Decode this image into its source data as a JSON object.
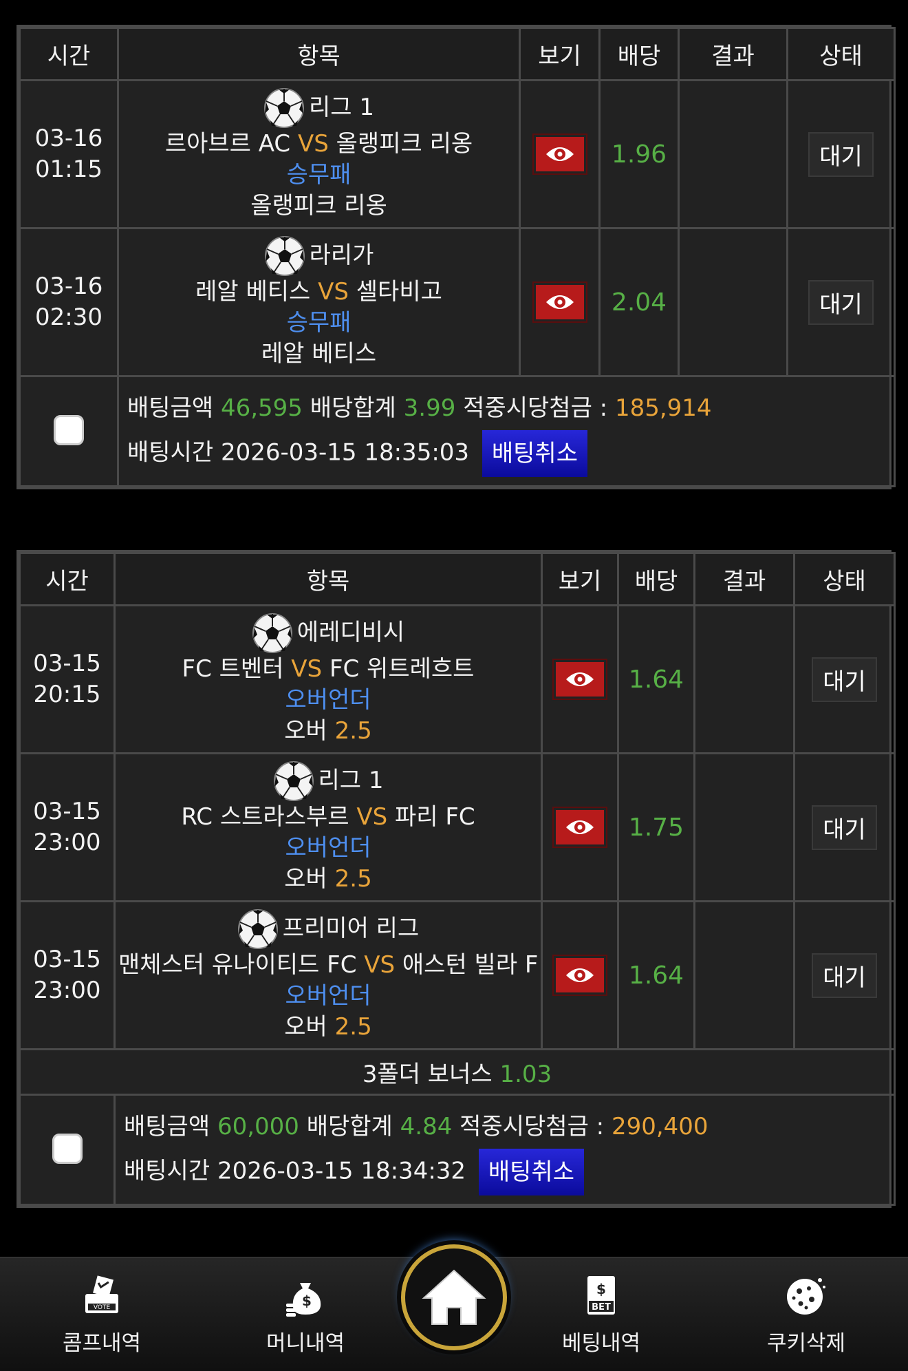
{
  "headers": {
    "time": "시간",
    "item": "항목",
    "view": "보기",
    "odds": "배당",
    "result": "결과",
    "status": "상태"
  },
  "colors": {
    "vs": "#e9a43a",
    "market": "#4e8ff0",
    "odds": "#57b046",
    "eye_button": "#b71b1b",
    "cancel_button": "#1a1ab8"
  },
  "slip1": {
    "rows": [
      {
        "date": "03-16",
        "time": "01:15",
        "league": "리그 1",
        "home": "르아브르 AC",
        "vs": "VS",
        "away": "올랭피크 리옹",
        "market": "승무패",
        "pick": "올랭피크 리옹",
        "odds": "1.96",
        "result": "",
        "status": "대기"
      },
      {
        "date": "03-16",
        "time": "02:30",
        "league": "라리가",
        "home": "레알 베티스",
        "vs": "VS",
        "away": "셀타비고",
        "market": "승무패",
        "pick": "레알 베티스",
        "odds": "2.04",
        "result": "",
        "status": "대기"
      }
    ],
    "summary": {
      "amount_label": "배팅금액",
      "amount": "46,595",
      "total_odds_label": "배당합계",
      "total_odds": "3.99",
      "payout_label": "적중시당첨금 :",
      "payout": "185,914",
      "bet_time_label": "배팅시간",
      "bet_time": "2026-03-15 18:35:03",
      "cancel_label": "배팅취소"
    }
  },
  "slip2": {
    "rows": [
      {
        "date": "03-15",
        "time": "20:15",
        "league": "에레디비시",
        "home": "FC 트벤터",
        "vs": "VS",
        "away": "FC 위트레흐트",
        "market": "오버언더",
        "pick_label": "오버",
        "pick_value": "2.5",
        "odds": "1.64",
        "result": "",
        "status": "대기"
      },
      {
        "date": "03-15",
        "time": "23:00",
        "league": "리그 1",
        "home": "RC 스트라스부르",
        "vs": "VS",
        "away": "파리 FC",
        "market": "오버언더",
        "pick_label": "오버",
        "pick_value": "2.5",
        "odds": "1.75",
        "result": "",
        "status": "대기"
      },
      {
        "date": "03-15",
        "time": "23:00",
        "league": "프리미어 리그",
        "home": "맨체스터 유나이티드 FC",
        "vs": "VS",
        "away": "애스턴 빌라 F",
        "market": "오버언더",
        "pick_label": "오버",
        "pick_value": "2.5",
        "odds": "1.64",
        "result": "",
        "status": "대기"
      }
    ],
    "bonus": {
      "label": "3폴더 보너스",
      "value": "1.03"
    },
    "summary": {
      "amount_label": "배팅금액",
      "amount": "60,000",
      "total_odds_label": "배당합계",
      "total_odds": "4.84",
      "payout_label": "적중시당첨금 :",
      "payout": "290,400",
      "bet_time_label": "배팅시간",
      "bet_time": "2026-03-15 18:34:32",
      "cancel_label": "배팅취소"
    }
  },
  "nav": {
    "comp": {
      "label": "콤프내역",
      "icon": "vote-box-icon",
      "icon_text": "VOTE"
    },
    "money": {
      "label": "머니내역",
      "icon": "money-bag-icon"
    },
    "home": {
      "icon": "home-icon"
    },
    "bet": {
      "label": "베팅내역",
      "icon": "bet-slip-icon",
      "icon_text": "BET"
    },
    "cookie": {
      "label": "쿠키삭제",
      "icon": "cookie-icon"
    }
  }
}
